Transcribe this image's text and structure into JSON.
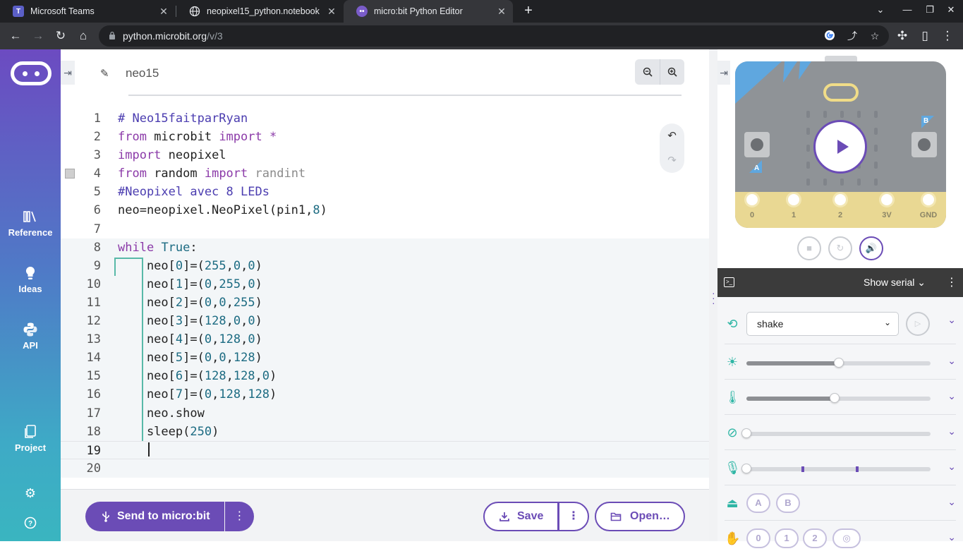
{
  "browser": {
    "tabs": [
      {
        "title": "Microsoft Teams",
        "icon": "teams-icon"
      },
      {
        "title": "neopixel15_python.notebook",
        "icon": "globe-icon"
      },
      {
        "title": "micro:bit Python Editor",
        "icon": "microbit-icon",
        "active": true
      }
    ],
    "url_host": "python.microbit.org",
    "url_path": "/v/3"
  },
  "sidebar": {
    "items": [
      {
        "label": "Reference",
        "icon": "reference-icon"
      },
      {
        "label": "Ideas",
        "icon": "lightbulb-icon"
      },
      {
        "label": "API",
        "icon": "python-icon"
      },
      {
        "label": "Project",
        "icon": "project-icon"
      }
    ]
  },
  "editor": {
    "project_name": "neo15",
    "current_line": 19,
    "lines": [
      "# Neo15faitparRyan",
      "from microbit import *",
      "import neopixel",
      "from random import randint",
      "#Neopixel avec 8 LEDs",
      "neo=neopixel.NeoPixel(pin1,8)",
      "",
      "while True:",
      "    neo[0]=(255,0,0)",
      "    neo[1]=(0,255,0)",
      "    neo[2]=(0,0,255)",
      "    neo[3]=(128,0,0)",
      "    neo[4]=(0,128,0)",
      "    neo[5]=(0,0,128)",
      "    neo[6]=(128,128,0)",
      "    neo[7]=(0,128,128)",
      "    neo.show",
      "    sleep(250)",
      "    ",
      ""
    ]
  },
  "bottom": {
    "send_label": "Send to micro:bit",
    "save_label": "Save",
    "open_label": "Open…"
  },
  "simulator": {
    "pins": [
      "0",
      "1",
      "2",
      "3V",
      "GND"
    ],
    "button_a": "A",
    "button_b": "B",
    "serial_label": "Show serial",
    "gesture": "shake",
    "light_level": 0.5,
    "temperature_level": 0.48,
    "compass_level": 0.0,
    "sound_level": 0.0,
    "buttons": [
      "A",
      "B"
    ],
    "touch_pins": [
      "0",
      "1",
      "2"
    ]
  },
  "colors": {
    "accent": "#6b4cb6",
    "teal": "#2fb6a5"
  }
}
